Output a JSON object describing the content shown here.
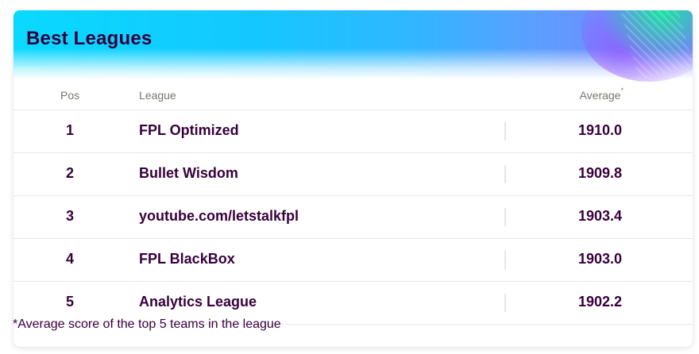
{
  "card": {
    "title": "Best Leagues"
  },
  "table": {
    "headers": {
      "pos": "Pos",
      "league": "League",
      "average": "Average",
      "average_marker": "*"
    },
    "rows": [
      {
        "pos": "1",
        "league": "FPL Optimized",
        "average": "1910.0"
      },
      {
        "pos": "2",
        "league": "Bullet Wisdom",
        "average": "1909.8"
      },
      {
        "pos": "3",
        "league": "youtube.com/letstalkfpl",
        "average": "1903.4"
      },
      {
        "pos": "4",
        "league": "FPL BlackBox",
        "average": "1903.0"
      },
      {
        "pos": "5",
        "league": "Analytics League",
        "average": "1902.2"
      }
    ]
  },
  "footnote": "*Average score of the top 5 teams in the league",
  "colors": {
    "text_primary": "#37003c",
    "header_gradient_start": "#09d9ff",
    "header_gradient_end": "#7d7dff",
    "accent_green": "#00ff87"
  }
}
